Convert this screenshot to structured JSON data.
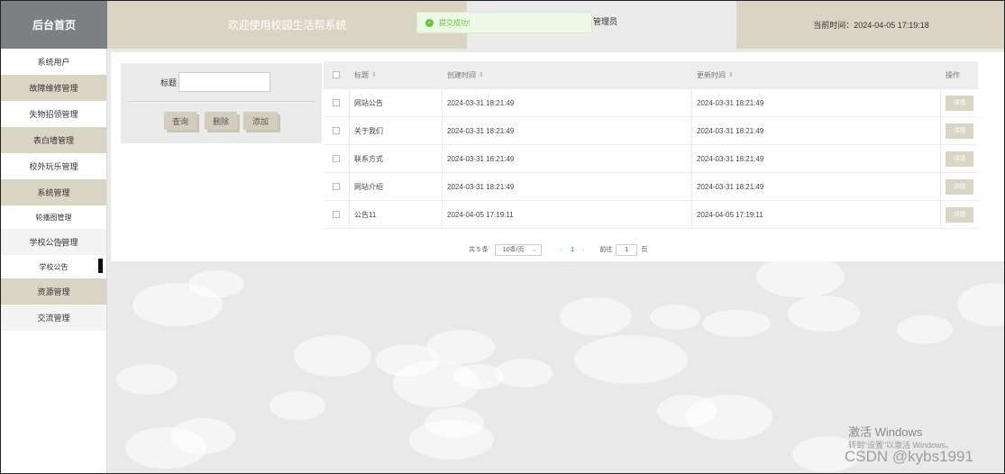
{
  "logo": "后台首页",
  "header": {
    "welcome": "欢迎使用校园生活帮系统",
    "user": "管理员",
    "time": "当前时间：2024-04-05 17:19:18"
  },
  "toast": "提交成功!",
  "sidebar": {
    "items": [
      {
        "label": "系统用户"
      },
      {
        "label": "故障维修管理"
      },
      {
        "label": "失物招领管理"
      },
      {
        "label": "表白墙管理"
      },
      {
        "label": "校外玩乐管理"
      },
      {
        "label": "系统管理"
      },
      {
        "label": "轮播图管理"
      },
      {
        "label": "学校公告管理"
      },
      {
        "label": "学校公告"
      },
      {
        "label": "资源管理"
      },
      {
        "label": "交流管理"
      }
    ]
  },
  "search": {
    "label": "标题",
    "value": "",
    "query_label": "查询",
    "delete_label": "删除",
    "add_label": "添加"
  },
  "table": {
    "headers": {
      "title": "标题",
      "created": "创建时间",
      "updated": "更新时间",
      "op": "操作"
    },
    "detail_label": "详情",
    "rows": [
      {
        "title": "网站公告",
        "created": "2024-03-31 18:21:49",
        "updated": "2024-03-31 18:21:49"
      },
      {
        "title": "关于我们",
        "created": "2024-03-31 18:21:49",
        "updated": "2024-03-31 18:21:49"
      },
      {
        "title": "联系方式",
        "created": "2024-03-31 18:21:49",
        "updated": "2024-03-31 18:21:49"
      },
      {
        "title": "网站介绍",
        "created": "2024-03-31 18:21:49",
        "updated": "2024-03-31 18:21:49"
      },
      {
        "title": "公告11",
        "created": "2024-04-05 17:19:11",
        "updated": "2024-04-05 17:19:11"
      }
    ]
  },
  "pagination": {
    "total": "共 5 条",
    "page_size": "10条/页",
    "current_page": "1",
    "goto_label": "前往",
    "goto_value": "1",
    "page_suffix": "页"
  },
  "watermark": {
    "line1": "激活 Windows",
    "line2": "转到“设置”以激活 Windows。",
    "csdn": "CSDN @kybs1991"
  }
}
